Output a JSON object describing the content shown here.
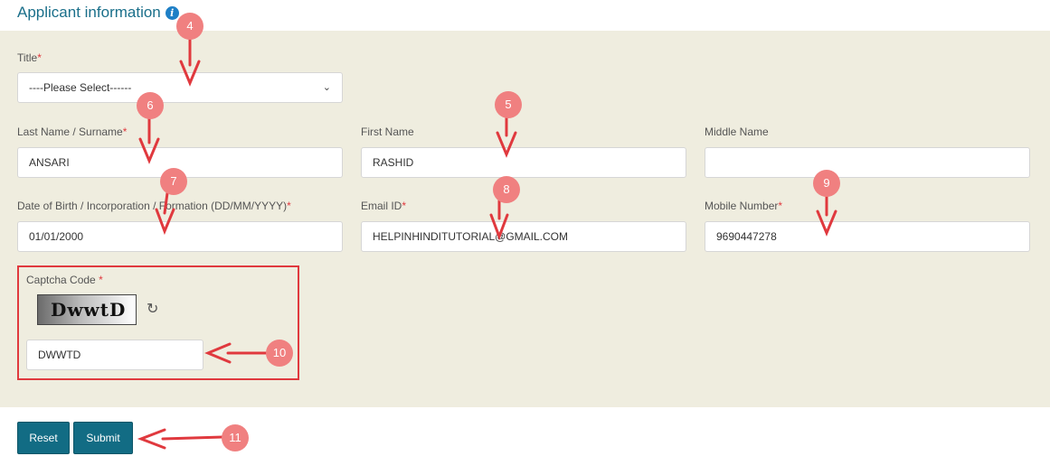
{
  "section": {
    "title": "Applicant information",
    "info_icon": "info-icon"
  },
  "form": {
    "title": {
      "label": "Title",
      "value": "----Please Select------"
    },
    "last_name": {
      "label": "Last Name / Surname",
      "value": "ANSARI"
    },
    "first_name": {
      "label": "First Name",
      "value": "RASHID"
    },
    "middle_name": {
      "label": "Middle Name",
      "value": ""
    },
    "dob": {
      "label": "Date of Birth / Incorporation / Formation (DD/MM/YYYY)",
      "value": "01/01/2000"
    },
    "email": {
      "label": "Email ID",
      "value": "HELPINHINDITUTORIAL@GMAIL.COM"
    },
    "mobile": {
      "label": "Mobile Number",
      "value": "9690447278"
    },
    "captcha": {
      "label": "Captcha Code",
      "image_text": "DwwtD",
      "value": "DWWTD",
      "refresh_icon": "refresh-icon"
    },
    "required_mark": "*"
  },
  "buttons": {
    "reset": "Reset",
    "submit": "Submit"
  },
  "annotations": [
    "4",
    "5",
    "6",
    "7",
    "8",
    "9",
    "10",
    "11"
  ],
  "colors": {
    "accent": "#126c84",
    "panel_bg": "#efeddf",
    "annotation": "#e0393e",
    "badge": "#f08080"
  }
}
